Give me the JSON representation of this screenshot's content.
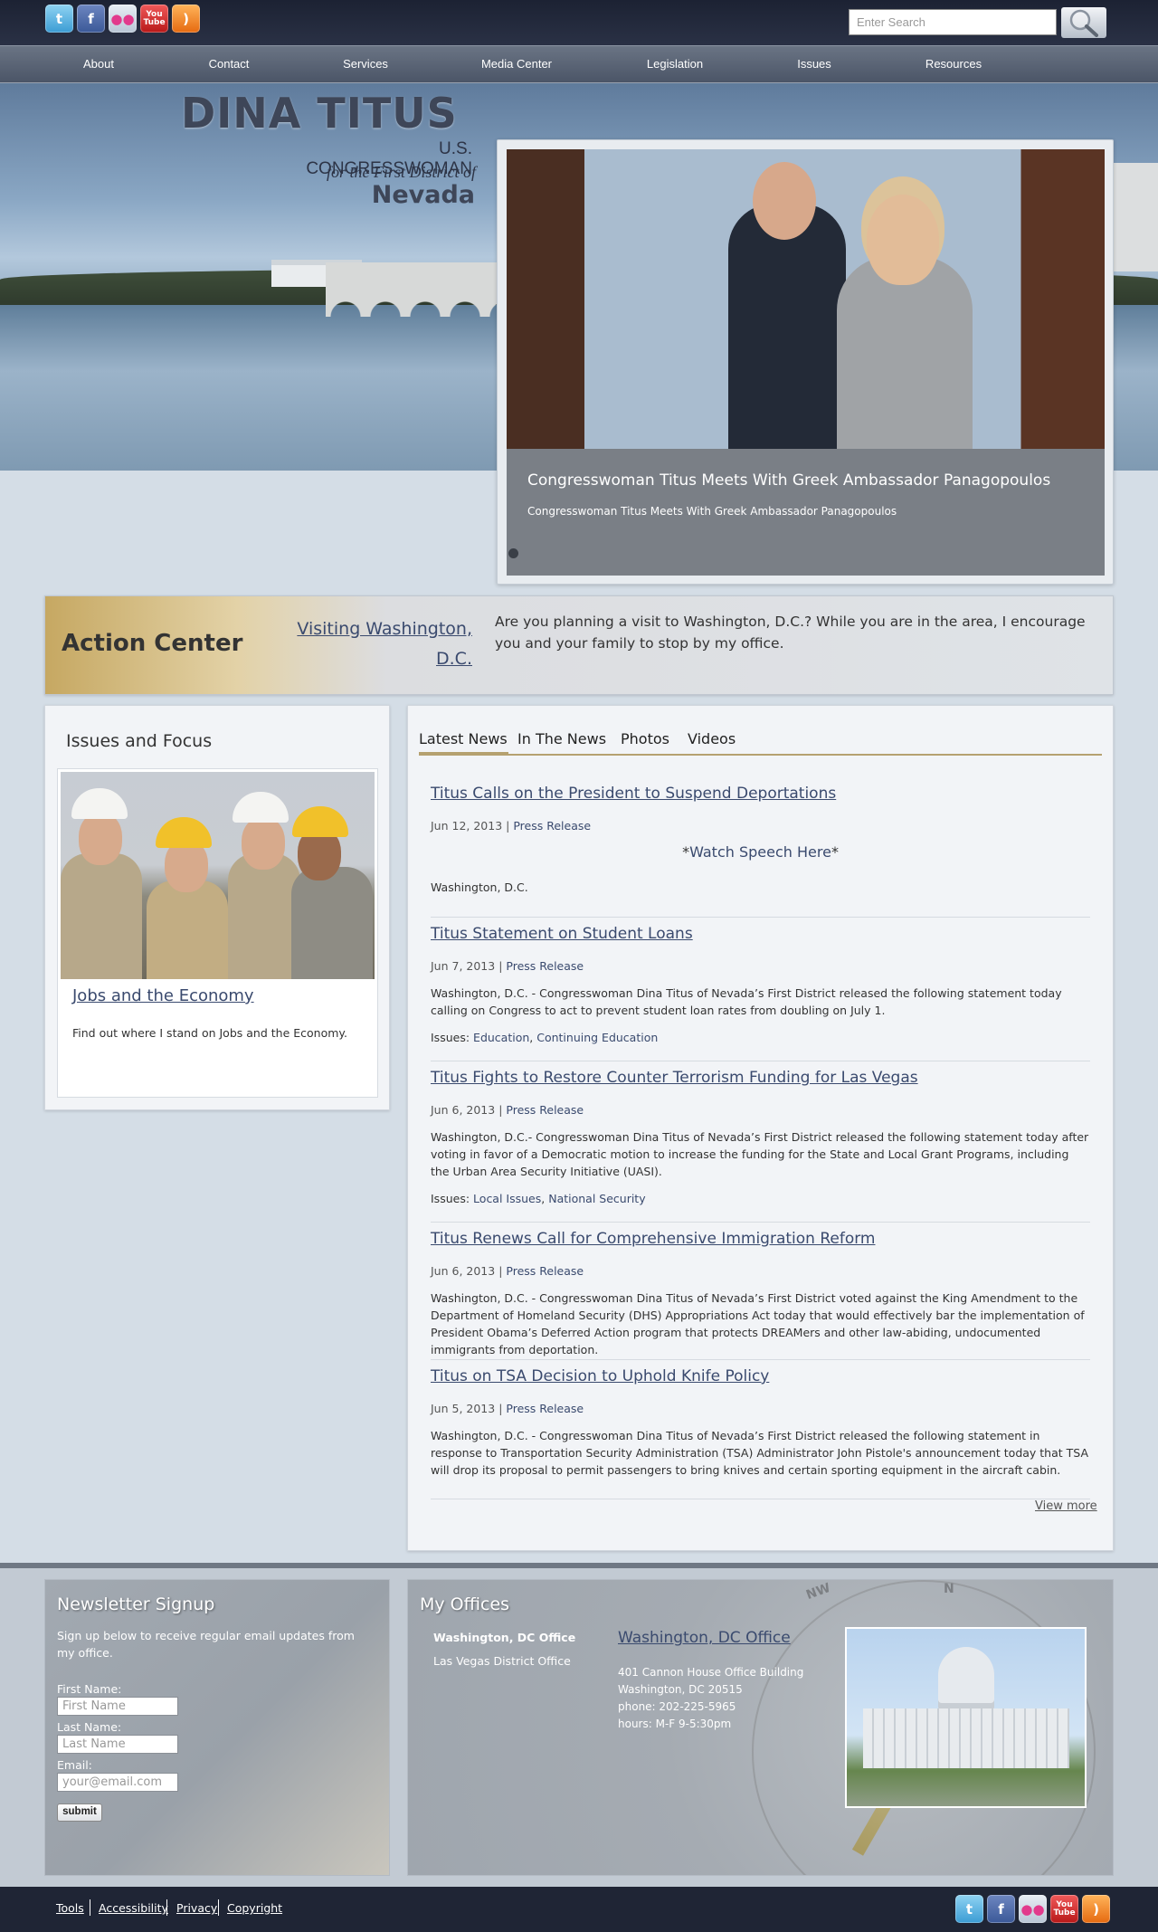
{
  "top": {
    "social": [
      {
        "icon": "twitter-icon",
        "glyph": "t"
      },
      {
        "icon": "facebook-icon",
        "glyph": "f"
      },
      {
        "icon": "flickr-icon",
        "glyph": "●●"
      },
      {
        "icon": "youtube-icon",
        "glyph": "You Tube"
      },
      {
        "icon": "rss-icon",
        "glyph": ")"
      }
    ],
    "search_placeholder": "Enter Search"
  },
  "nav": [
    "About",
    "Contact",
    "Services",
    "Media Center",
    "Legislation",
    "Issues",
    "Resources"
  ],
  "brand": {
    "name": "DINA TITUS",
    "line1": "U.S. CONGRESSWOMAN",
    "line2": "for the First District of",
    "line3": "Nevada"
  },
  "slider": {
    "title": "Congresswoman Titus Meets With Greek Ambassador Panagopoulos",
    "subtitle": "Congresswoman Titus Meets With Greek Ambassador Panagopoulos"
  },
  "action": {
    "title": "Action Center",
    "link": "Visiting Washington, D.C.",
    "text": "Are you planning a visit to Washington, D.C.? While you are in the area, I encourage you and your family to stop by my office."
  },
  "issues": {
    "title": "Issues and Focus",
    "link": "Jobs and the Economy",
    "desc": "Find out where I stand on Jobs and the Economy."
  },
  "news": {
    "tabs": [
      "Latest News",
      "In The News",
      "Photos",
      "Videos"
    ],
    "articles": [
      {
        "title": "Titus Calls on the President to Suspend Deportations",
        "date": "Jun 12, 2013",
        "category": "Press Release",
        "watch_prefix": "*",
        "watch_link": "Watch Speech Here",
        "watch_suffix": "*",
        "body": "Washington, D.C."
      },
      {
        "title": "Titus Statement on Student Loans",
        "date": "Jun 7, 2013",
        "category": "Press Release",
        "body": "Washington, D.C. - Congresswoman Dina Titus of Nevada’s First District released the following statement today calling on Congress to act to prevent student loan rates from doubling on July 1.",
        "issues_label": "Issues:",
        "issues": [
          "Education",
          "Continuing Education"
        ]
      },
      {
        "title": "Titus Fights to Restore Counter Terrorism Funding for Las Vegas",
        "date": "Jun 6, 2013",
        "category": "Press Release",
        "body": "Washington, D.C.- Congresswoman Dina Titus of Nevada’s First District released the following statement today after voting in favor of a Democratic motion to increase the funding for the State and Local Grant Programs, including the Urban Area Security Initiative (UASI).",
        "issues_label": "Issues:",
        "issues": [
          "Local Issues",
          "National Security"
        ]
      },
      {
        "title": "Titus Renews Call for Comprehensive Immigration Reform",
        "date": "Jun 6, 2013",
        "category": "Press Release",
        "body": "Washington, D.C. - Congresswoman Dina Titus of Nevada’s First District voted against the King Amendment to the Department of Homeland Security (DHS) Appropriations Act today that would effectively bar the implementation of President Obama’s Deferred Action program that protects DREAMers and other law-abiding, undocumented immigrants from deportation."
      },
      {
        "title": "Titus on TSA Decision to Uphold Knife Policy",
        "date": "Jun 5, 2013",
        "category": "Press Release",
        "body": "Washington, D.C. - Congresswoman Dina Titus of Nevada’s First District released the following statement in response to Transportation Security Administration (TSA) Administrator John Pistole's announcement today that TSA will drop its proposal to permit passengers to bring knives and certain sporting equipment in the aircraft cabin."
      }
    ],
    "view_more": "View more"
  },
  "newsletter": {
    "title": "Newsletter Signup",
    "text": "Sign up below to receive regular email updates from my office.",
    "first_label": "First Name:",
    "first_placeholder": "First Name",
    "last_label": "Last Name:",
    "last_placeholder": "Last Name",
    "email_label": "Email:",
    "email_placeholder": "your@email.com",
    "submit": "submit"
  },
  "offices": {
    "title": "My Offices",
    "tabs": [
      "Washington, DC Office",
      "Las Vegas District Office"
    ],
    "name": "Washington, DC Office",
    "lines": [
      "401 Cannon House Office Building",
      "Washington, DC 20515",
      "phone: 202-225-5965",
      "hours: M-F 9-5:30pm"
    ],
    "compass_labels": [
      "NW",
      "N"
    ]
  },
  "footer": [
    "Tools",
    "Accessibility",
    "Privacy",
    "Copyright"
  ]
}
